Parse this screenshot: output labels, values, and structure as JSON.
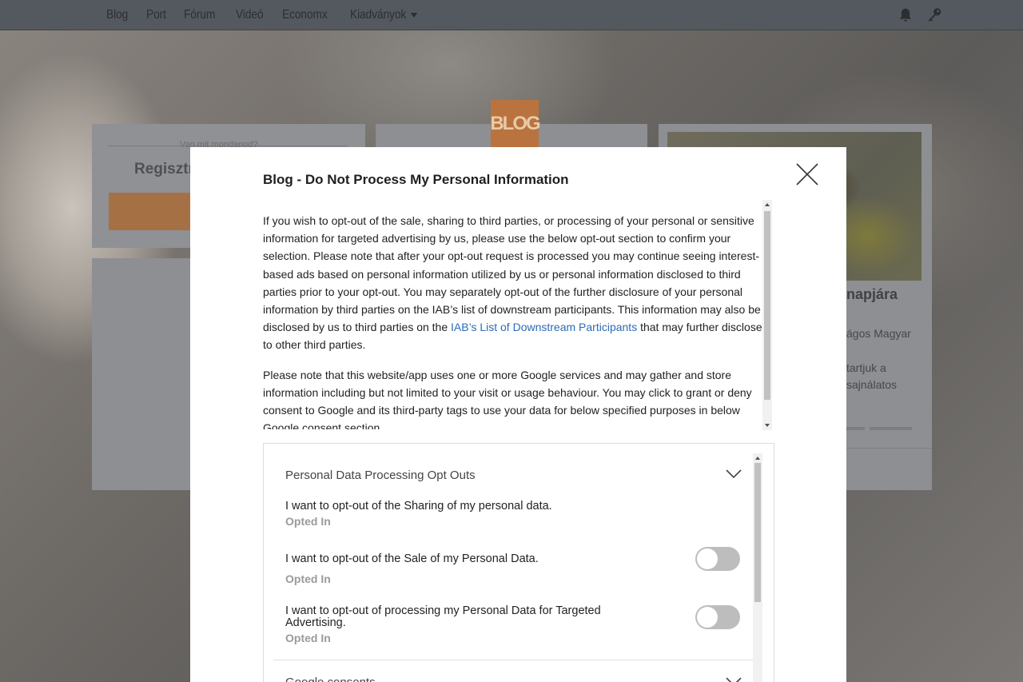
{
  "topbar": {
    "nav": [
      "Blog",
      "Port",
      "Fórum",
      "Videó",
      "Economx",
      "Kiadványok"
    ],
    "icons": [
      "bell-icon",
      "key-icon"
    ]
  },
  "background": {
    "registration": {
      "small": "Van mit mondanod?",
      "title": "Regisztr"
    },
    "logo_text": "BLOG",
    "right_card": {
      "title": "napjára",
      "line1": "ágos Magyar",
      "line2": "tartjuk a",
      "line3": "sajnálatos"
    }
  },
  "modal": {
    "title": "Blog - Do Not Process My Personal Information",
    "close_icon": "close-icon",
    "paragraph1_before_link": "If you wish to opt-out of the sale, sharing to third parties, or processing of your personal or sensitive information for targeted advertising by us, please use the below opt-out section to confirm your selection. Please note that after your opt-out request is processed you may continue seeing interest-based ads based on personal information utilized by us or personal information disclosed to third parties prior to your opt-out. You may separately opt-out of the further disclosure of your personal information by third parties on the IAB’s list of downstream participants. This information may also be disclosed by us to third parties on the ",
    "paragraph1_link": "IAB’s List of Downstream Participants",
    "paragraph1_after_link": " that may further disclose it to other third parties.",
    "paragraph2": "Please note that this website/app uses one or more Google services and may gather and store information including but not limited to your visit or usage behaviour. You may click to grant or deny consent to Google and its third-party tags to use your data for below specified purposes in below Google consent section.",
    "section1_title": "Personal Data Processing Opt Outs",
    "items": [
      {
        "title": "I want to opt-out of the Sharing of my personal data.",
        "status": "Opted In"
      },
      {
        "title": "I want to opt-out of the Sale of my Personal Data.",
        "status": "Opted In"
      },
      {
        "title": "I want to opt-out of processing my Personal Data for Targeted Advertising.",
        "status": "Opted In"
      }
    ],
    "section2_title": "Google consents"
  }
}
